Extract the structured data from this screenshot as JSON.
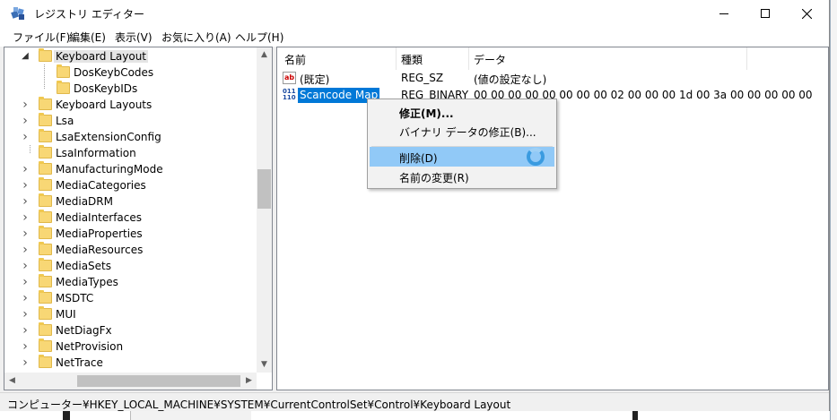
{
  "window": {
    "title": "レジストリ エディター"
  },
  "menu": [
    "ファイル(F)",
    "編集(E)",
    "表示(V)",
    "お気に入り(A)",
    "ヘルプ(H)"
  ],
  "tree": {
    "items": [
      {
        "label": "Keyboard Layout",
        "expander": "expanded",
        "selected": true
      },
      {
        "label": "DosKeybCodes",
        "expander": "none"
      },
      {
        "label": "DosKeybIDs",
        "expander": "none"
      },
      {
        "label": "Keyboard Layouts",
        "expander": "collapsed"
      },
      {
        "label": "Lsa",
        "expander": "collapsed"
      },
      {
        "label": "LsaExtensionConfig",
        "expander": "collapsed"
      },
      {
        "label": "LsaInformation",
        "expander": "none"
      },
      {
        "label": "ManufacturingMode",
        "expander": "collapsed"
      },
      {
        "label": "MediaCategories",
        "expander": "collapsed"
      },
      {
        "label": "MediaDRM",
        "expander": "collapsed"
      },
      {
        "label": "MediaInterfaces",
        "expander": "collapsed"
      },
      {
        "label": "MediaProperties",
        "expander": "collapsed"
      },
      {
        "label": "MediaResources",
        "expander": "collapsed"
      },
      {
        "label": "MediaSets",
        "expander": "collapsed"
      },
      {
        "label": "MediaTypes",
        "expander": "collapsed"
      },
      {
        "label": "MSDTC",
        "expander": "collapsed"
      },
      {
        "label": "MUI",
        "expander": "collapsed"
      },
      {
        "label": "NetDiagFx",
        "expander": "collapsed"
      },
      {
        "label": "NetProvision",
        "expander": "collapsed"
      },
      {
        "label": "NetTrace",
        "expander": "collapsed"
      }
    ]
  },
  "values": {
    "headers": {
      "name": "名前",
      "type": "種類",
      "data": "データ"
    },
    "rows": [
      {
        "icon": "string-value-icon",
        "icon_text": "ab",
        "name": "(既定)",
        "type": "REG_SZ",
        "data": "(値の設定なし)",
        "selected": false
      },
      {
        "icon": "binary-value-icon",
        "icon_text": "011\n110",
        "name": "Scancode Map",
        "type": "REG_BINARY",
        "data": "00 00 00 00 00 00 00 00 02 00 00 00 1d 00 3a 00 00 00 00 00",
        "selected": true
      }
    ]
  },
  "context_menu": {
    "items": [
      {
        "label": "修正(M)...",
        "bold": true
      },
      {
        "label": "バイナリ データの修正(B)..."
      },
      {
        "label": "削除(D)",
        "hover": true
      },
      {
        "label": "名前の変更(R)"
      }
    ]
  },
  "status": {
    "path": "コンピューター¥HKEY_LOCAL_MACHINE¥SYSTEM¥CurrentControlSet¥Control¥Keyboard Layout"
  },
  "colors": {
    "selection": "#0078d7",
    "menu_hover": "#91c9f7",
    "folder": "#f8d775"
  }
}
